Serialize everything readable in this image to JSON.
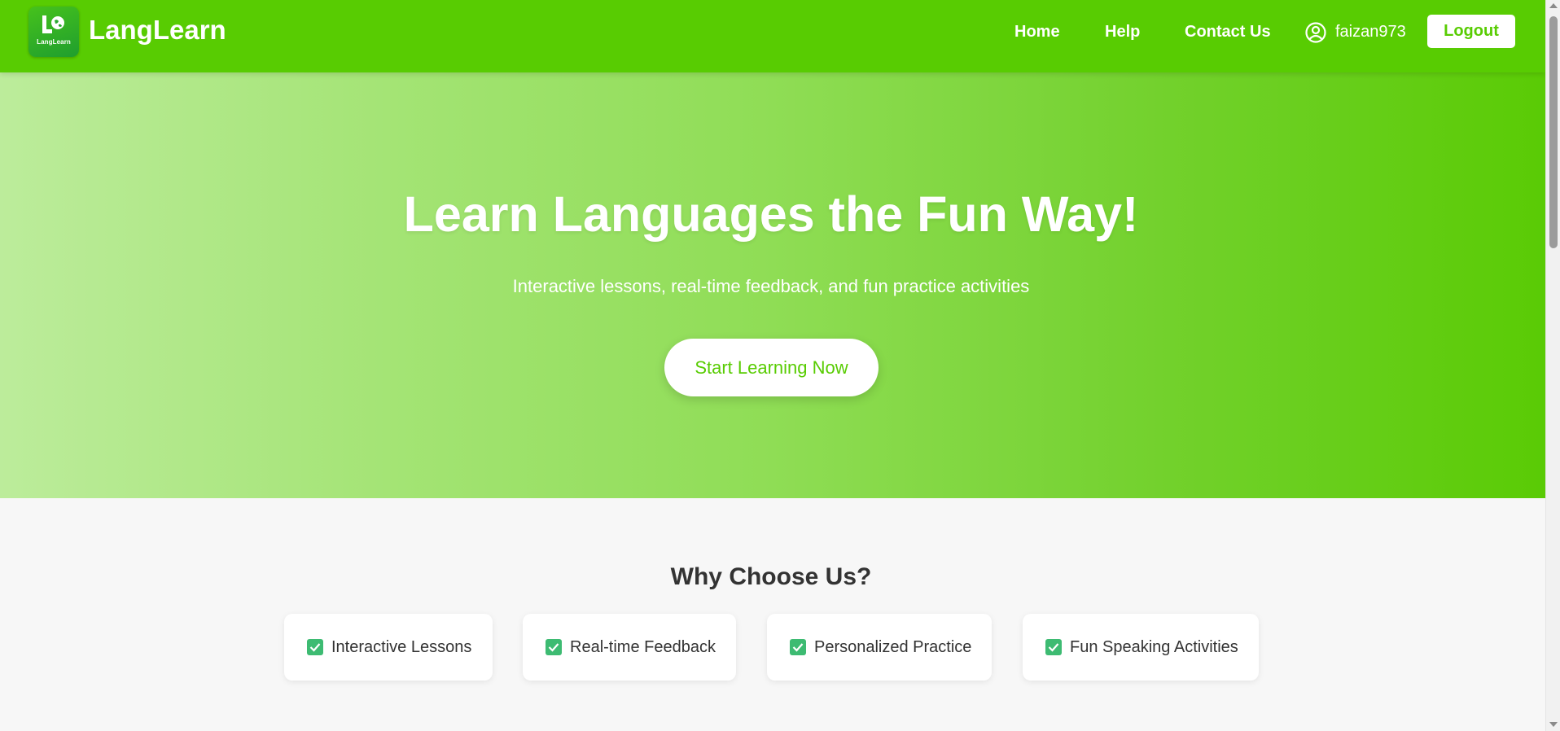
{
  "colors": {
    "brand_green": "#58cc02",
    "check_green": "#3dbb72",
    "text_dark": "#333333",
    "page_bg": "#f7f7f7"
  },
  "navbar": {
    "logo_caption": "LangLearn",
    "logo_icon": "globe-book-icon",
    "brand": "LangLearn",
    "links": [
      "Home",
      "Help",
      "Contact Us"
    ],
    "user_icon": "user-circle-icon",
    "username": "faizan973",
    "logout_label": "Logout"
  },
  "hero": {
    "title": "Learn Languages the Fun Way!",
    "subtitle": "Interactive lessons, real-time feedback, and fun practice activities",
    "cta_label": "Start Learning Now"
  },
  "features": {
    "title": "Why Choose Us?",
    "check_icon": "check-box-icon",
    "items": [
      "Interactive Lessons",
      "Real-time Feedback",
      "Personalized Practice",
      "Fun Speaking Activities"
    ]
  }
}
